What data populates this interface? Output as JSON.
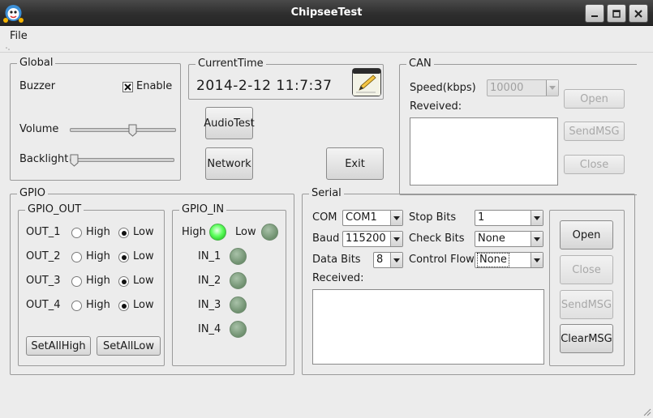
{
  "window": {
    "title": "ChipseeTest",
    "controls": {
      "minimize": "minimize-icon",
      "maximize": "maximize-icon",
      "close": "close-icon"
    }
  },
  "menu": {
    "file": "File"
  },
  "global": {
    "title": "Global",
    "buzzer_label": "Buzzer",
    "enable_label": "Enable",
    "enable_checked": true,
    "volume_label": "Volume",
    "volume_value": 0.6,
    "backlight_label": "Backlight",
    "backlight_value": 0.0
  },
  "current_time": {
    "title": "CurrentTime",
    "value": "2014-2-12  11:7:37",
    "icon": "notepad-pencil-icon"
  },
  "buttons": {
    "audio_test": "AudioTest",
    "network": "Network",
    "exit": "Exit"
  },
  "can": {
    "title": "CAN",
    "speed_label": "Speed(kbps)",
    "speed_value": "10000",
    "received_label": "Reveived:",
    "open": "Open",
    "send_msg": "SendMSG",
    "close": "Close"
  },
  "gpio": {
    "title": "GPIO",
    "out": {
      "title": "GPIO_OUT",
      "rows": [
        {
          "label": "OUT_1",
          "high": "High",
          "low": "Low",
          "selected": "low"
        },
        {
          "label": "OUT_2",
          "high": "High",
          "low": "Low",
          "selected": "low"
        },
        {
          "label": "OUT_3",
          "high": "High",
          "low": "Low",
          "selected": "low"
        },
        {
          "label": "OUT_4",
          "high": "High",
          "low": "Low",
          "selected": "low"
        }
      ],
      "set_all_high": "SetAllHigh",
      "set_all_low": "SetAllLow"
    },
    "in": {
      "title": "GPIO_IN",
      "legend_high": "High",
      "legend_low": "Low",
      "inputs": [
        {
          "label": "IN_1",
          "state": "low"
        },
        {
          "label": "IN_2",
          "state": "low"
        },
        {
          "label": "IN_3",
          "state": "low"
        },
        {
          "label": "IN_4",
          "state": "low"
        }
      ]
    }
  },
  "serial": {
    "title": "Serial",
    "com_label": "COM",
    "com_value": "COM1",
    "baud_label": "Baud",
    "baud_value": "115200",
    "data_bits_label": "Data Bits",
    "data_bits_value": "8",
    "stop_bits_label": "Stop  Bits",
    "stop_bits_value": "1",
    "check_bits_label": "Check Bits",
    "check_bits_value": "None",
    "control_flow_label": "Control Flow",
    "control_flow_value": "None",
    "received_label": "Received:",
    "open": "Open",
    "close": "Close",
    "send_msg": "SendMSG",
    "clear_msg": "ClearMSG"
  },
  "colors": {
    "titlebar": "#2e2e2e",
    "background": "#ececec",
    "led_on": "#5dff5d",
    "led_off": "#7f9f7f"
  }
}
